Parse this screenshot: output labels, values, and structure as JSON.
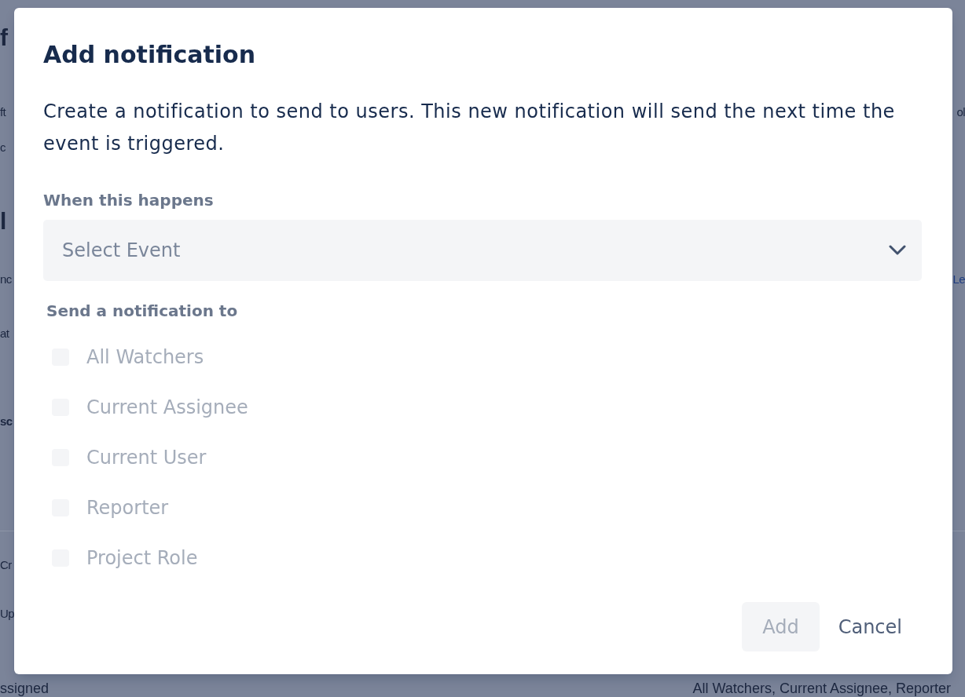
{
  "background_page": {
    "left_fragments": [
      {
        "text": "f",
        "kind": "heading"
      },
      {
        "text": "ft",
        "kind": "text"
      },
      {
        "text": "c",
        "kind": "text"
      },
      {
        "text": "l",
        "kind": "heading"
      },
      {
        "text": "nc",
        "kind": "text"
      },
      {
        "text": "at",
        "kind": "text"
      },
      {
        "text": "sc",
        "kind": "strong"
      },
      {
        "text": "Cr",
        "kind": "text"
      },
      {
        "text": "Up",
        "kind": "text"
      }
    ],
    "right_fragments": [
      {
        "text": "ol",
        "kind": "text"
      },
      {
        "text": "Le",
        "kind": "link"
      }
    ],
    "bottom_left": "ssigned",
    "bottom_right": "All Watchers, Current Assignee, Reporter"
  },
  "dialog": {
    "title": "Add notification",
    "description": "Create a notification to send to users. This new notification will send the next time the event is triggered.",
    "event_field": {
      "label": "When this happens",
      "placeholder": "Select Event"
    },
    "recipients": {
      "label": "Send a notification to",
      "options": [
        {
          "label": "All Watchers",
          "checked": false,
          "disabled": true
        },
        {
          "label": "Current Assignee",
          "checked": false,
          "disabled": true
        },
        {
          "label": "Current User",
          "checked": false,
          "disabled": true
        },
        {
          "label": "Reporter",
          "checked": false,
          "disabled": true
        },
        {
          "label": "Project Role",
          "checked": false,
          "disabled": true
        }
      ]
    },
    "buttons": [
      {
        "label": "Add",
        "kind": "primary",
        "disabled": true
      },
      {
        "label": "Cancel",
        "kind": "subtle",
        "disabled": false
      }
    ]
  }
}
